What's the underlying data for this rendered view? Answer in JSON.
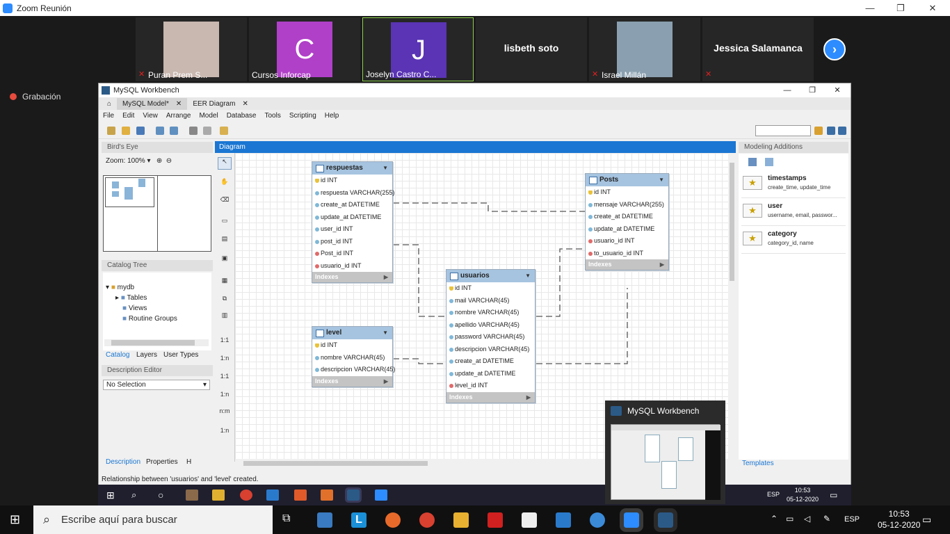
{
  "zoom": {
    "title": "Zoom Reunión",
    "recording": "Grabación"
  },
  "participants": [
    {
      "name": "Puran Prem S...",
      "initial": "",
      "color": "#c8b8b0",
      "muted": true
    },
    {
      "name": "Cursos Inforcap",
      "initial": "C",
      "color": "#b040c8",
      "muted": false
    },
    {
      "name": "Joselyn Castro C...",
      "initial": "J",
      "color": "#5a34b4",
      "muted": false
    },
    {
      "name": "lisbeth soto",
      "initial": "",
      "color": "",
      "muted": false
    },
    {
      "name": "Israel Millán",
      "initial": "",
      "color": "#8aa0b0",
      "muted": true
    },
    {
      "name": "Jessica Salamanca",
      "initial": "",
      "color": "",
      "muted": true
    }
  ],
  "wb": {
    "title": "MySQL Workbench",
    "tabs": [
      "MySQL Model*",
      "EER Diagram"
    ],
    "menu": [
      "File",
      "Edit",
      "View",
      "Arrange",
      "Model",
      "Database",
      "Tools",
      "Scripting",
      "Help"
    ],
    "birds_eye": "Bird's Eye",
    "zoom_label": "Zoom:",
    "zoom_value": "100%",
    "catalog_tree": "Catalog Tree",
    "tree": {
      "db": "mydb",
      "items": [
        "Tables",
        "Views",
        "Routine Groups"
      ]
    },
    "catalog_tabs": [
      "Catalog",
      "Layers",
      "User Types"
    ],
    "desc_editor": "Description Editor",
    "desc_select": "No Selection",
    "bottom_tabs": [
      "Description",
      "Properties",
      "H"
    ],
    "diagram": "Diagram",
    "status": "Relationship between 'usuarios' and 'level' created.",
    "modeling": "Modeling Additions",
    "templates": "Templates",
    "snippets": [
      {
        "title": "timestamps",
        "desc": "create_time, update_time"
      },
      {
        "title": "user",
        "desc": "username, email, passwor..."
      },
      {
        "title": "category",
        "desc": "category_id, name"
      }
    ],
    "palette": [
      "1:1",
      "1:n",
      "1:1",
      "1:n",
      "n:m",
      "1:n"
    ]
  },
  "tables": {
    "respuestas": {
      "name": "respuestas",
      "cols": [
        [
          "id INT",
          "pk"
        ],
        [
          "respuesta VARCHAR(255)",
          ""
        ],
        [
          "create_at DATETIME",
          ""
        ],
        [
          "update_at DATETIME",
          ""
        ],
        [
          "user_id INT",
          ""
        ],
        [
          "post_id INT",
          ""
        ],
        [
          "Post_id INT",
          "fk"
        ],
        [
          "usuario_id INT",
          "fk"
        ]
      ]
    },
    "posts": {
      "name": "Posts",
      "cols": [
        [
          "id INT",
          "pk"
        ],
        [
          "mensaje VARCHAR(255)",
          ""
        ],
        [
          "create_at DATETIME",
          ""
        ],
        [
          "update_at DATETIME",
          ""
        ],
        [
          "usuario_id INT",
          "fk"
        ],
        [
          "to_usuario_id INT",
          "fk"
        ]
      ]
    },
    "usuarios": {
      "name": "usuarios",
      "cols": [
        [
          "id INT",
          "pk"
        ],
        [
          "mail VARCHAR(45)",
          ""
        ],
        [
          "nombre VARCHAR(45)",
          ""
        ],
        [
          "apellido VARCHAR(45)",
          ""
        ],
        [
          "password VARCHAR(45)",
          ""
        ],
        [
          "descripcion VARCHAR(45)",
          ""
        ],
        [
          "create_at DATETIME",
          ""
        ],
        [
          "update_at DATETIME",
          ""
        ],
        [
          "level_id INT",
          "fk"
        ]
      ]
    },
    "level": {
      "name": "level",
      "cols": [
        [
          "id INT",
          "pk"
        ],
        [
          "nombre VARCHAR(45)",
          ""
        ],
        [
          "descripcion VARCHAR(45)",
          ""
        ]
      ]
    },
    "indexes": "Indexes"
  },
  "inner_tray": {
    "lang": "ESP",
    "time": "10:53",
    "date": "05-12-2020"
  },
  "popup": {
    "title": "MySQL Workbench"
  },
  "taskbar": {
    "search": "Escribe aquí para buscar",
    "lang": "ESP",
    "time": "10:53",
    "date": "05-12-2020"
  }
}
